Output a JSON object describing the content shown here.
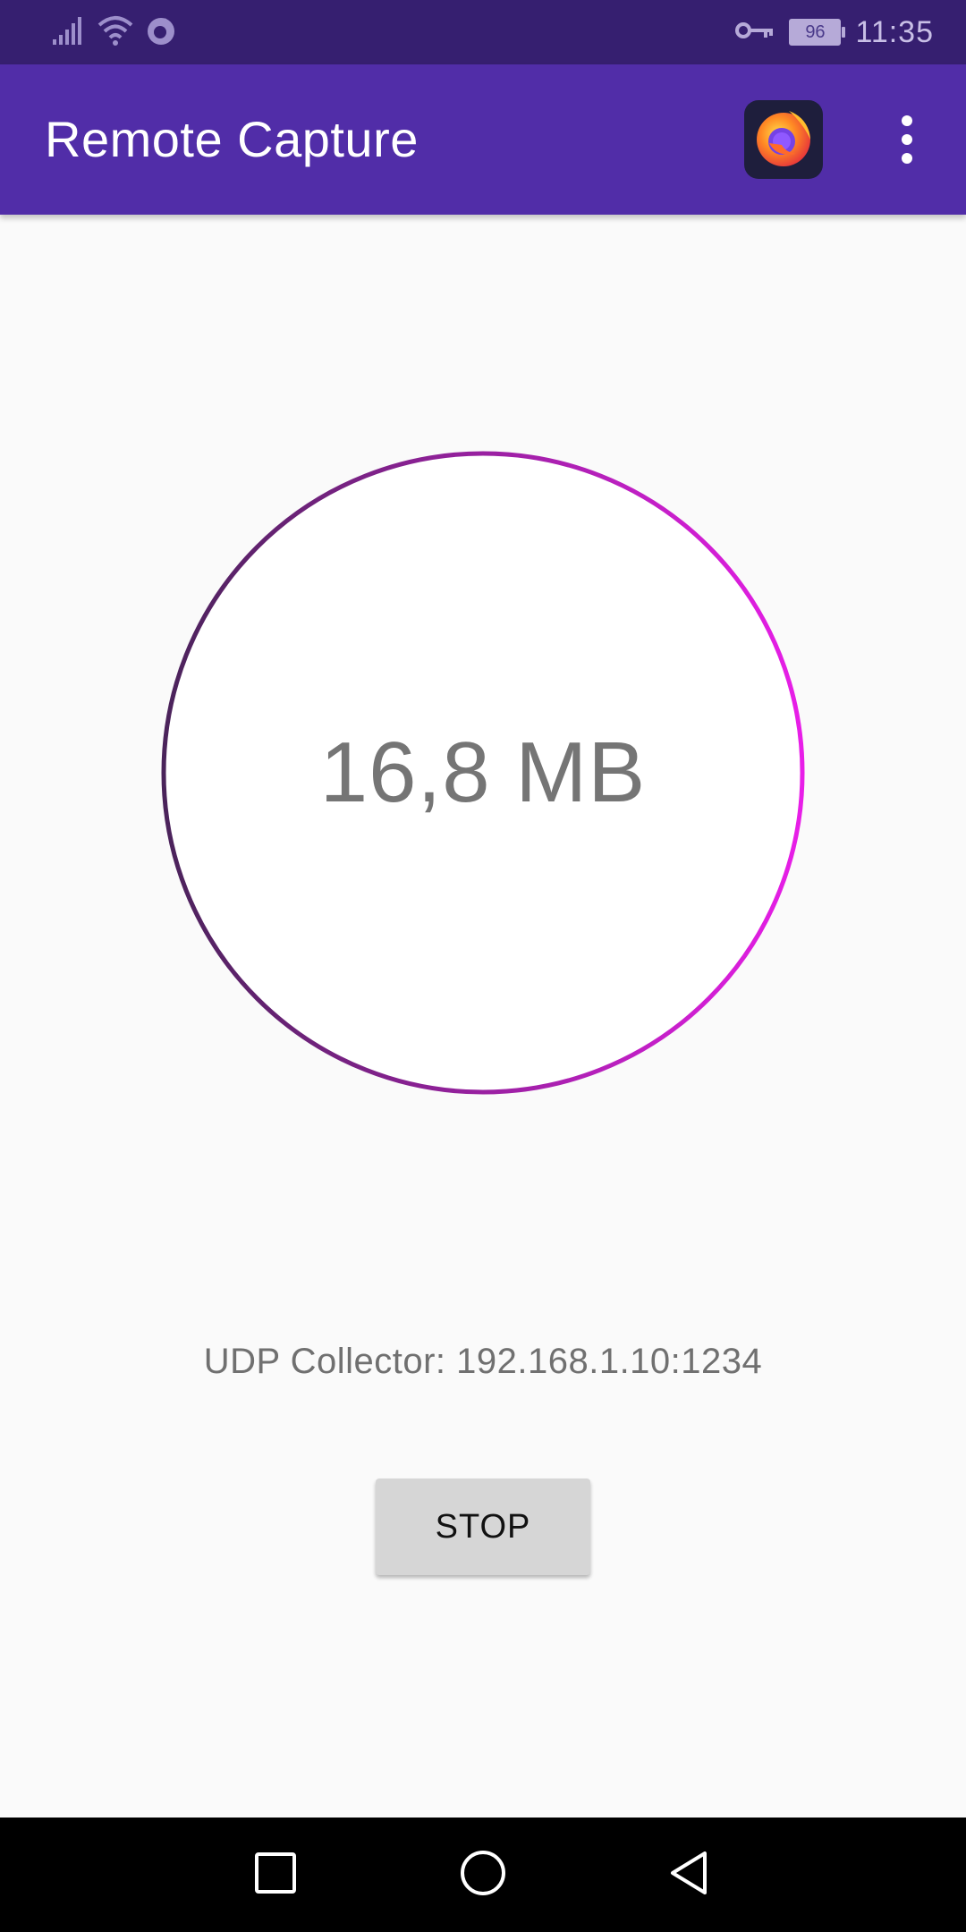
{
  "status_bar": {
    "time": "11:35",
    "battery_level": "96",
    "icons": [
      "signal-icon",
      "wifi-icon",
      "firefox-notification-icon",
      "vpn-key-icon",
      "battery-icon"
    ]
  },
  "app_bar": {
    "title": "Remote Capture",
    "app_icon": "firefox-icon",
    "menu_icon": "more-vert-icon",
    "color": "#512da8"
  },
  "capture": {
    "size_text": "16,8 MB",
    "ring_gradient": [
      "#4a235a",
      "#e81ee8"
    ],
    "collector_text": "UDP Collector: 192.168.1.10:1234"
  },
  "actions": {
    "stop_label": "STOP"
  },
  "navigation": {
    "icons": [
      "recents-square-icon",
      "home-circle-icon",
      "back-triangle-icon"
    ]
  }
}
